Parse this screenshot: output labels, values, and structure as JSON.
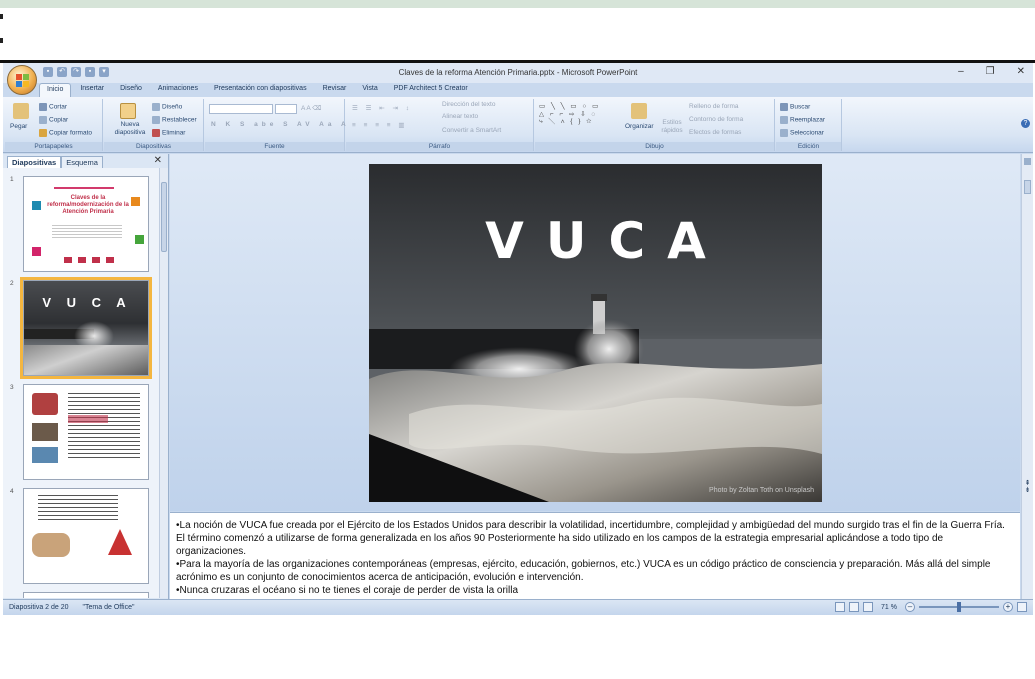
{
  "window": {
    "title": "Claves de la reforma Atención Primaria.pptx - Microsoft PowerPoint",
    "controls": [
      "–",
      "❐",
      "✕"
    ]
  },
  "tabs": [
    {
      "label": "Inicio",
      "active": true
    },
    {
      "label": "Insertar"
    },
    {
      "label": "Diseño"
    },
    {
      "label": "Animaciones"
    },
    {
      "label": "Presentación con diapositivas"
    },
    {
      "label": "Revisar"
    },
    {
      "label": "Vista"
    },
    {
      "label": "PDF Architect 5 Creator"
    }
  ],
  "ribbon": {
    "portapapeles": {
      "label": "Portapapeles",
      "paste": "Pegar",
      "cut": "Cortar",
      "copy": "Copiar",
      "format": "Copiar formato"
    },
    "diapositivas": {
      "label": "Diapositivas",
      "new_slide": "Nueva diapositiva",
      "design": "Diseño",
      "reset": "Restablecer",
      "delete": "Eliminar"
    },
    "fuente": {
      "label": "Fuente"
    },
    "parrafo": {
      "label": "Párrafo",
      "text_direction": "Dirección del texto",
      "align_text": "Alinear texto",
      "smartart": "Convertir a SmartArt"
    },
    "dibujo": {
      "label": "Dibujo",
      "arrange": "Organizar",
      "quick_styles": "Estilos rápidos",
      "fill": "Relleno de forma",
      "outline": "Contorno de forma",
      "effects": "Efectos de formas"
    },
    "edicion": {
      "label": "Edición",
      "find": "Buscar",
      "replace": "Reemplazar",
      "select": "Seleccionar"
    }
  },
  "panel": {
    "tab_slides": "Diapositivas",
    "tab_outline": "Esquema",
    "slides": [
      {
        "num": "1",
        "title": "Claves de la reforma/modernización de la Atención Primaria"
      },
      {
        "num": "2",
        "title": "V U C A",
        "selected": true
      },
      {
        "num": "3"
      },
      {
        "num": "4"
      }
    ]
  },
  "slide": {
    "title": "VUCA",
    "credit": "Photo by Zoltan Toth on Unsplash"
  },
  "notes": [
    "•La noción de VUCA fue creada por el Ejército de los Estados Unidos para describir la volatilidad, incertidumbre, complejidad y ambigüedad del mundo surgido tras el fin de la Guerra Fría. El término comenzó a utilizarse de forma generalizada en los años 90 Posteriormente ha sido utilizado en los campos de la estrategia empresarial aplicándose a todo tipo de organizaciones.",
    "•Para la mayoría de las organizaciones contemporáneas (empresas, ejército, educación, gobiernos, etc.) VUCA es un código práctico de consciencia y preparación. Más allá del simple acrónimo es un conjunto de conocimientos acerca de anticipación, evolución e intervención.",
    "•Nunca cruzaras el océano si no te tienes el coraje de perder de vista la orilla"
  ],
  "status": {
    "slide_counter": "Diapositiva 2 de 20",
    "theme": "\"Tema de Office\"",
    "zoom": "71 %"
  }
}
